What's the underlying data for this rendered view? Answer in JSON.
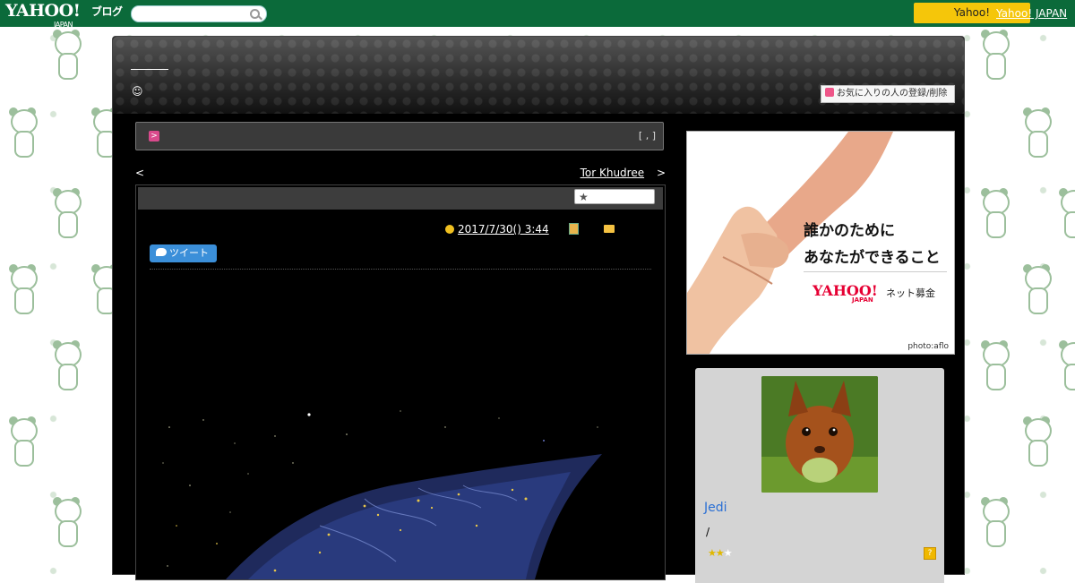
{
  "topbar": {
    "logo": "YAHOO!",
    "logo_sub": "JAPAN",
    "logo_blog": "ブログ",
    "search_placeholder": "",
    "promo_button": "Yahoo!",
    "top_link": "Yahoo! JAPAN"
  },
  "header": {
    "blog_title": "",
    "smiley": "☺",
    "favorite_button": "お気に入りの人の登録/削除"
  },
  "category_bar": {
    "icon": ">",
    "count": "[ , ]"
  },
  "nav": {
    "prev_symbol": "<",
    "prev_label": "",
    "next_label": "Tor Khudree",
    "next_symbol": ">"
  },
  "post": {
    "star_icon": "★",
    "date": "2017/7/30()  3:44",
    "category_link": "",
    "tweet_label": "ツイート"
  },
  "ad": {
    "line1": "誰かのために",
    "line2": "あなたができること",
    "logo": "YAHOO!",
    "logo_sub": "JAPAN",
    "service": "ネット募金",
    "credit": "photo:aflo"
  },
  "profile": {
    "name": "Jedi",
    "slash": "/",
    "rating_stars_filled": 2,
    "rating_stars_total": 3,
    "stars_on": "★★",
    "stars_off": "★",
    "help_icon": "?"
  },
  "colors": {
    "topbar": "#0b6a3a",
    "promo": "#f5c60a",
    "profile_name": "#2a6fd4"
  }
}
